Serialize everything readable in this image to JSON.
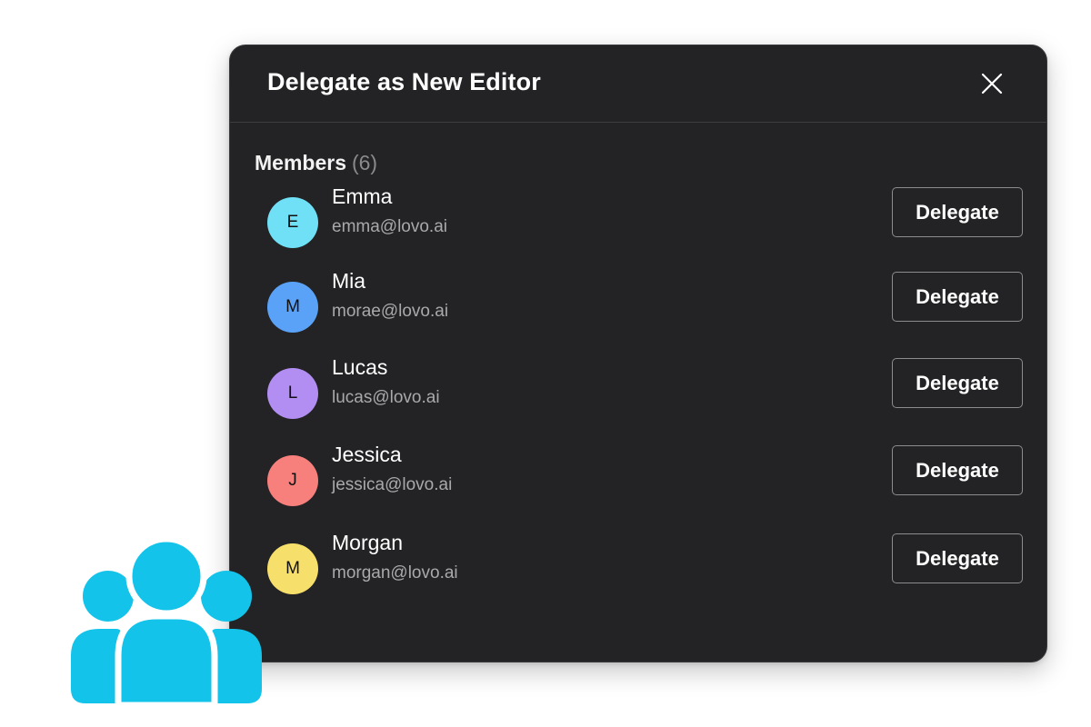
{
  "dialog": {
    "title": "Delegate as New Editor",
    "close_icon": "close-icon"
  },
  "members_section": {
    "label": "Members",
    "count": "(6)"
  },
  "members": [
    {
      "initial": "E",
      "name": "Emma",
      "email": "emma@lovo.ai",
      "avatar_color": "#6fe0f5",
      "action_label": "Delegate"
    },
    {
      "initial": "M",
      "name": "Mia",
      "email": "morae@lovo.ai",
      "avatar_color": "#5aa2f7",
      "action_label": "Delegate"
    },
    {
      "initial": "L",
      "name": "Lucas",
      "email": "lucas@lovo.ai",
      "avatar_color": "#b28ef2",
      "action_label": "Delegate"
    },
    {
      "initial": "J",
      "name": "Jessica",
      "email": "jessica@lovo.ai",
      "avatar_color": "#f77f7c",
      "action_label": "Delegate"
    },
    {
      "initial": "M",
      "name": "Morgan",
      "email": "morgan@lovo.ai",
      "avatar_color": "#f7df6b",
      "action_label": "Delegate"
    }
  ],
  "decoration": {
    "icon": "group-users-icon",
    "color": "#14c3ea"
  },
  "colors": {
    "dialog_background": "#232325",
    "text_primary": "#ffffff",
    "text_secondary": "#a9a9ad"
  }
}
